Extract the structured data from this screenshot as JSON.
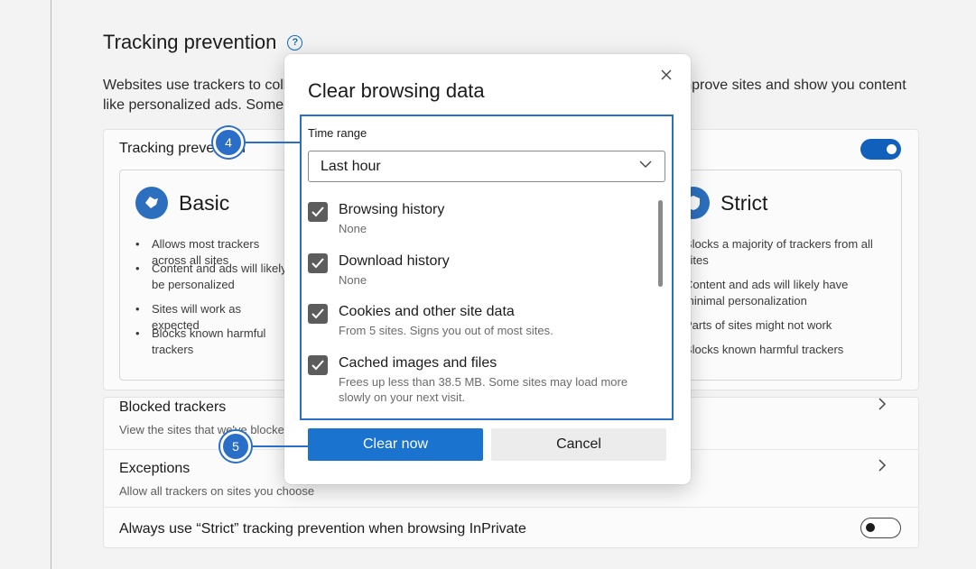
{
  "settings": {
    "section_title": "Tracking prevention",
    "description": "Websites use trackers to collect data about your browsing. Websites may use this data to improve sites and show you content like personalized ads. Some trackers collect and send your info to sites you haven't visited.",
    "tp_label": "Tracking prevention",
    "basic": {
      "title": "Basic",
      "bullets": [
        "Allows most trackers across all sites",
        "Content and ads will likely be personalized",
        "Sites will work as expected",
        "Blocks known harmful trackers"
      ]
    },
    "strict": {
      "title": "Strict",
      "bullets": [
        "Blocks a majority of trackers from all sites",
        "Content and ads will likely have minimal personalization",
        "Parts of sites might not work",
        "Blocks known harmful trackers"
      ]
    },
    "blocked_trackers": {
      "title": "Blocked trackers",
      "sub": "View the sites that we've blocked from tracking you"
    },
    "exceptions": {
      "title": "Exceptions",
      "sub": "Allow all trackers on sites you choose"
    },
    "inprivate": {
      "title": "Always use “Strict” tracking prevention when browsing InPrivate"
    },
    "tp_toggle_on": true,
    "inprivate_toggle_on": false
  },
  "dialog": {
    "title": "Clear browsing data",
    "time_range_label": "Time range",
    "time_range_value": "Last hour",
    "items": [
      {
        "title": "Browsing history",
        "sub": "None",
        "checked": true
      },
      {
        "title": "Download history",
        "sub": "None",
        "checked": true
      },
      {
        "title": "Cookies and other site data",
        "sub": "From 5 sites. Signs you out of most sites.",
        "checked": true
      },
      {
        "title": "Cached images and files",
        "sub": "Frees up less than 38.5 MB. Some sites may load more slowly on your next visit.",
        "checked": true
      }
    ],
    "clear_button": "Clear now",
    "cancel_button": "Cancel"
  },
  "callouts": {
    "first": "4",
    "second": "5"
  },
  "colors": {
    "accent": "#1a73cf",
    "highlight": "#2a6ec8"
  }
}
